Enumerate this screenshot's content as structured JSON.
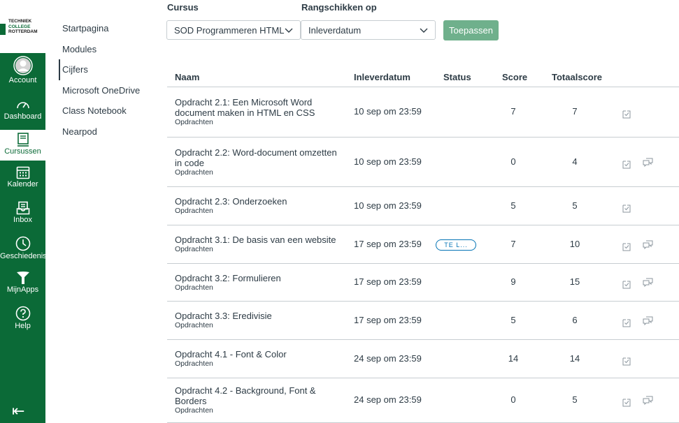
{
  "logo": {
    "line1": "TECHNIEK",
    "line2": "COLLEGE",
    "line3": "ROTTERDAM"
  },
  "global_nav": [
    {
      "label": "Account",
      "icon": "account-icon"
    },
    {
      "label": "Dashboard",
      "icon": "dashboard-icon"
    },
    {
      "label": "Cursussen",
      "icon": "courses-icon",
      "active": true
    },
    {
      "label": "Kalender",
      "icon": "calendar-icon"
    },
    {
      "label": "Inbox",
      "icon": "inbox-icon"
    },
    {
      "label": "Geschiedenis",
      "icon": "history-icon"
    },
    {
      "label": "MijnApps",
      "icon": "apps-icon"
    },
    {
      "label": "Help",
      "icon": "help-icon"
    }
  ],
  "course_nav": [
    "Startpagina",
    "Modules",
    "Cijfers",
    "Microsoft OneDrive",
    "Class Notebook",
    "Nearpod"
  ],
  "filters": {
    "course_label": "Cursus",
    "course_value": "SOD Programmeren HTML",
    "sort_label": "Rangschikken op",
    "sort_value": "Inleverdatum",
    "apply": "Toepassen"
  },
  "table": {
    "headers": {
      "name": "Naam",
      "due": "Inleverdatum",
      "status": "Status",
      "score": "Score",
      "total": "Totaalscore"
    },
    "rows": [
      {
        "name": "Opdracht 2.1: Een Microsoft Word document maken in HTML en CSS",
        "group": "Opdrachten",
        "due": "10 sep om 23:59",
        "status": "",
        "score": "7",
        "total": "7",
        "comments": false
      },
      {
        "name": "Opdracht 2.2: Word-document omzetten in code",
        "group": "Opdrachten",
        "due": "10 sep om 23:59",
        "status": "",
        "score": "0",
        "total": "4",
        "comments": true
      },
      {
        "name": "Opdracht 2.3: Onderzoeken",
        "group": "Opdrachten",
        "due": "10 sep om 23:59",
        "status": "",
        "score": "5",
        "total": "5",
        "comments": false
      },
      {
        "name": "Opdracht 3.1: De basis van een website",
        "group": "Opdrachten",
        "due": "17 sep om 23:59",
        "status": "TE L...",
        "score": "7",
        "total": "10",
        "comments": true
      },
      {
        "name": "Opdracht 3.2: Formulieren",
        "group": "Opdrachten",
        "due": "17 sep om 23:59",
        "status": "",
        "score": "9",
        "total": "15",
        "comments": true
      },
      {
        "name": "Opdracht 3.3: Eredivisie",
        "group": "Opdrachten",
        "due": "17 sep om 23:59",
        "status": "",
        "score": "5",
        "total": "6",
        "comments": true
      },
      {
        "name": "Opdracht 4.1 - Font & Color",
        "group": "Opdrachten",
        "due": "24 sep om 23:59",
        "status": "",
        "score": "14",
        "total": "14",
        "comments": false
      },
      {
        "name": "Opdracht 4.2 - Background, Font & Borders",
        "group": "Opdrachten",
        "due": "24 sep om 23:59",
        "status": "",
        "score": "0",
        "total": "5",
        "comments": true
      }
    ]
  },
  "colors": {
    "brand": "#0b6a37",
    "button": "#6fb08c",
    "badge": "#0374b5"
  }
}
